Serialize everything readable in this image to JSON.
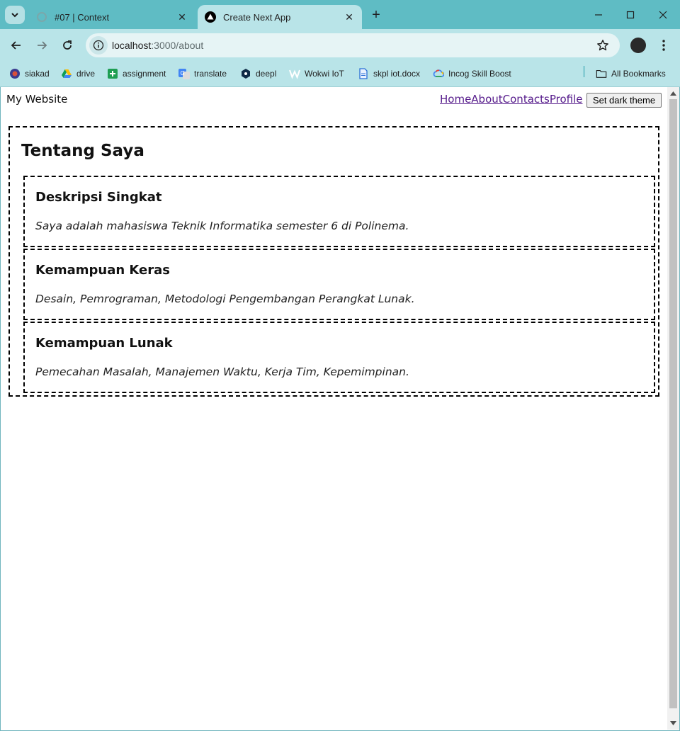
{
  "browser": {
    "tabs": [
      {
        "title": "#07 | Context",
        "active": false
      },
      {
        "title": "Create Next App",
        "active": true
      }
    ],
    "url_host": "localhost",
    "url_path": ":3000/about",
    "bookmarks": [
      {
        "label": "siakad",
        "icon": "university-seal-icon"
      },
      {
        "label": "drive",
        "icon": "google-drive-icon"
      },
      {
        "label": "assignment",
        "icon": "google-sheets-icon"
      },
      {
        "label": "translate",
        "icon": "google-translate-icon"
      },
      {
        "label": "deepl",
        "icon": "deepl-icon"
      },
      {
        "label": "Wokwi IoT",
        "icon": "wokwi-icon"
      },
      {
        "label": "skpl iot.docx",
        "icon": "document-icon"
      },
      {
        "label": "Incog Skill Boost",
        "icon": "google-cloud-icon"
      }
    ],
    "all_bookmarks_label": "All Bookmarks",
    "colors": {
      "tabstrip": "#5fbcc4",
      "toolbar": "#b9e4e8",
      "omnibox": "#e6f4f5"
    }
  },
  "page": {
    "site_title": "My Website",
    "nav": [
      "Home",
      "About",
      "Contacts",
      "Profile"
    ],
    "theme_button": "Set dark theme",
    "about_title": "Tentang Saya",
    "sections": [
      {
        "heading": "Deskripsi Singkat",
        "text": "Saya adalah mahasiswa Teknik Informatika semester 6 di Polinema."
      },
      {
        "heading": "Kemampuan Keras",
        "text": "Desain, Pemrograman, Metodologi Pengembangan Perangkat Lunak."
      },
      {
        "heading": "Kemampuan Lunak",
        "text": "Pemecahan Masalah, Manajemen Waktu, Kerja Tim, Kepemimpinan."
      }
    ]
  }
}
